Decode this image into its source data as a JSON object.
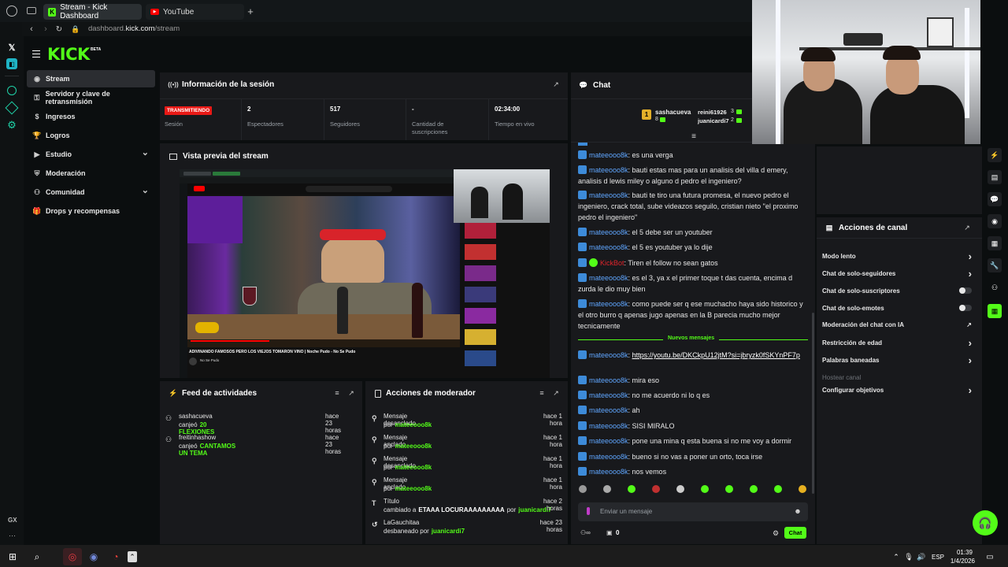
{
  "browser": {
    "tabs": [
      {
        "label": "Stream - Kick Dashboard"
      },
      {
        "label": "YouTube"
      }
    ],
    "new_tab": "+",
    "address": "dashboard.kick.com/stream",
    "address_domain": "kick.com",
    "address_prefix": "dashboard.",
    "address_suffix": "/stream",
    "opera_bottom": "GX",
    "opera_more": "···"
  },
  "kick": {
    "logo": "KICK",
    "logo_beta": "BETA",
    "nav": [
      {
        "label": "Stream",
        "icon": "stream-icon"
      },
      {
        "label": "Servidor y clave de retransmisión",
        "icon": "key-icon"
      },
      {
        "label": "Ingresos",
        "icon": "money-icon"
      },
      {
        "label": "Logros",
        "icon": "trophy-icon"
      },
      {
        "label": "Estudio",
        "icon": "studio-icon",
        "chevron": true
      },
      {
        "label": "Moderación",
        "icon": "shield-icon"
      },
      {
        "label": "Comunidad",
        "icon": "community-icon",
        "chevron": true
      },
      {
        "label": "Drops y recompensas",
        "icon": "gift-icon"
      }
    ]
  },
  "session": {
    "title": "Información de la sesión",
    "status_badge": "TRANSMITIENDO",
    "stats": [
      {
        "value": "",
        "label": "Sesión"
      },
      {
        "value": "2",
        "label": "Espectadores"
      },
      {
        "value": "517",
        "label": "Seguidores"
      },
      {
        "value": "-",
        "label": "Cantidad de suscripciones"
      },
      {
        "value": "02:34:00",
        "label": "Tiempo en vivo"
      }
    ]
  },
  "preview": {
    "title": "Vista previa del stream",
    "caption": "ADIVINANDO FAMOSOS PERO LOS VIEJOS TOMARON VINO | Noche Pudo - No Se Pudo",
    "channel": "No Se Pudo"
  },
  "feed": {
    "title": "Feed de actividades",
    "items": [
      {
        "user": "sashacueva",
        "action": "canjeó",
        "reward": "20 FLEXIONES",
        "time": "hace 23 horas"
      },
      {
        "user": "freitinhashow",
        "action": "canjeó",
        "reward": "CANTAMOS UN TEMA",
        "time": "hace 23 horas"
      }
    ]
  },
  "modactions": {
    "title": "Acciones de moderador",
    "items": [
      {
        "title": "Mensaje desanclado",
        "by": "por",
        "user": "mateeooo8k",
        "time": "hace 1 hora"
      },
      {
        "title": "Mensaje anclado",
        "by": "por",
        "user": "mateeooo8k",
        "time": "hace 1 hora"
      },
      {
        "title": "Mensaje desanclado",
        "by": "por",
        "user": "mateeooo8k",
        "time": "hace 1 hora"
      },
      {
        "title": "Mensaje anclado",
        "by": "por",
        "user": "mateeooo8k",
        "time": "hace 1 hora"
      },
      {
        "title": "Título",
        "by": "cambiado a",
        "extra": "ETAAA LOCURAAAAAAAAA",
        "by2": "por",
        "user": "juanicardi7",
        "time": "hace 2 horas"
      },
      {
        "title": "LaGauchitaa",
        "by": "desbaneado por",
        "user": "juanicardi7",
        "time": "hace 23 horas"
      }
    ]
  },
  "chat": {
    "title": "Chat",
    "top_gifters": [
      {
        "rank": "1",
        "name": "sashacueva",
        "count": "8"
      },
      {
        "name": "reini61926",
        "count": "3"
      },
      {
        "name": "juanicardi7",
        "count": "2"
      }
    ],
    "messages": [
      {
        "user": "mateeooo8k",
        "text": ": es una verga"
      },
      {
        "user": "mateeooo8k",
        "text": ": bauti estas mas para un analisis del villa d emery, analisis d lewis miley o alguno d pedro el ingeniero?"
      },
      {
        "user": "mateeooo8k",
        "text": ": bauti te tiro una futura promesa, el nuevo pedro el ingeniero, crack total, sube videazos seguilo, cristian nieto \"el proximo pedro el ingeniero\""
      },
      {
        "user": "mateeooo8k",
        "text": ": el 5 debe ser un youtuber"
      },
      {
        "user": "mateeooo8k",
        "text": ": el 5 es youtuber ya lo dije"
      },
      {
        "user": "KickBot",
        "text": ": Tiren el follow no sean gatos"
      },
      {
        "user": "mateeooo8k",
        "text": ": es el 3, ya x el primer toque t das cuenta, encima d zurda le dio muy bien"
      },
      {
        "user": "mateeooo8k",
        "text": ": como puede ser q ese muchacho haya sido historico y el otro burro q apenas jugo apenas en la B parecia mucho mejor tecnicamente"
      }
    ],
    "new_messages": "Nuevos mensajes",
    "messages2": [
      {
        "user": "mateeooo8k",
        "text": ": ",
        "link": "https://youtu.be/DKCkpU12jtM?si=jbryzk0fSKYnPF7p"
      },
      {
        "user": "mateeooo8k",
        "text": ": mira eso"
      },
      {
        "user": "mateeooo8k",
        "text": ": no me acuerdo ni lo q es"
      },
      {
        "user": "mateeooo8k",
        "text": ": ah"
      },
      {
        "user": "mateeooo8k",
        "text": ": SISI MIRALO"
      },
      {
        "user": "mateeooo8k",
        "text": ": pone una mina q esta buena si no me voy a dormir"
      },
      {
        "user": "mateeooo8k",
        "text": ": bueno si no vas a poner un orto, toca irse"
      },
      {
        "user": "mateeooo8k",
        "text": ": nos vemos"
      }
    ],
    "input_placeholder": "Enviar un mensaje",
    "points": "0",
    "send_label": "Chat"
  },
  "channel_actions": {
    "title": "Acciones de canal",
    "items": [
      {
        "label": "Modo lento",
        "control": "chevron"
      },
      {
        "label": "Chat de solo-seguidores",
        "control": "chevron"
      },
      {
        "label": "Chat de solo-suscriptores",
        "control": "toggle"
      },
      {
        "label": "Chat de solo-emotes",
        "control": "toggle"
      },
      {
        "label": "Moderación del chat con IA",
        "control": "external"
      },
      {
        "label": "Restricción de edad",
        "control": "chevron"
      },
      {
        "label": "Palabras baneadas",
        "control": "chevron"
      },
      {
        "label": "Hostear canal",
        "control": "none",
        "disabled": true
      },
      {
        "label": "Configurar objetivos",
        "control": "chevron"
      }
    ]
  },
  "taskbar": {
    "lang": "ESP",
    "time": "01:39",
    "date": "1/4/2026"
  },
  "colors": {
    "accent": "#53fc18",
    "panel": "#18191c",
    "live": "#e91916",
    "username": "#5fa6ff"
  }
}
